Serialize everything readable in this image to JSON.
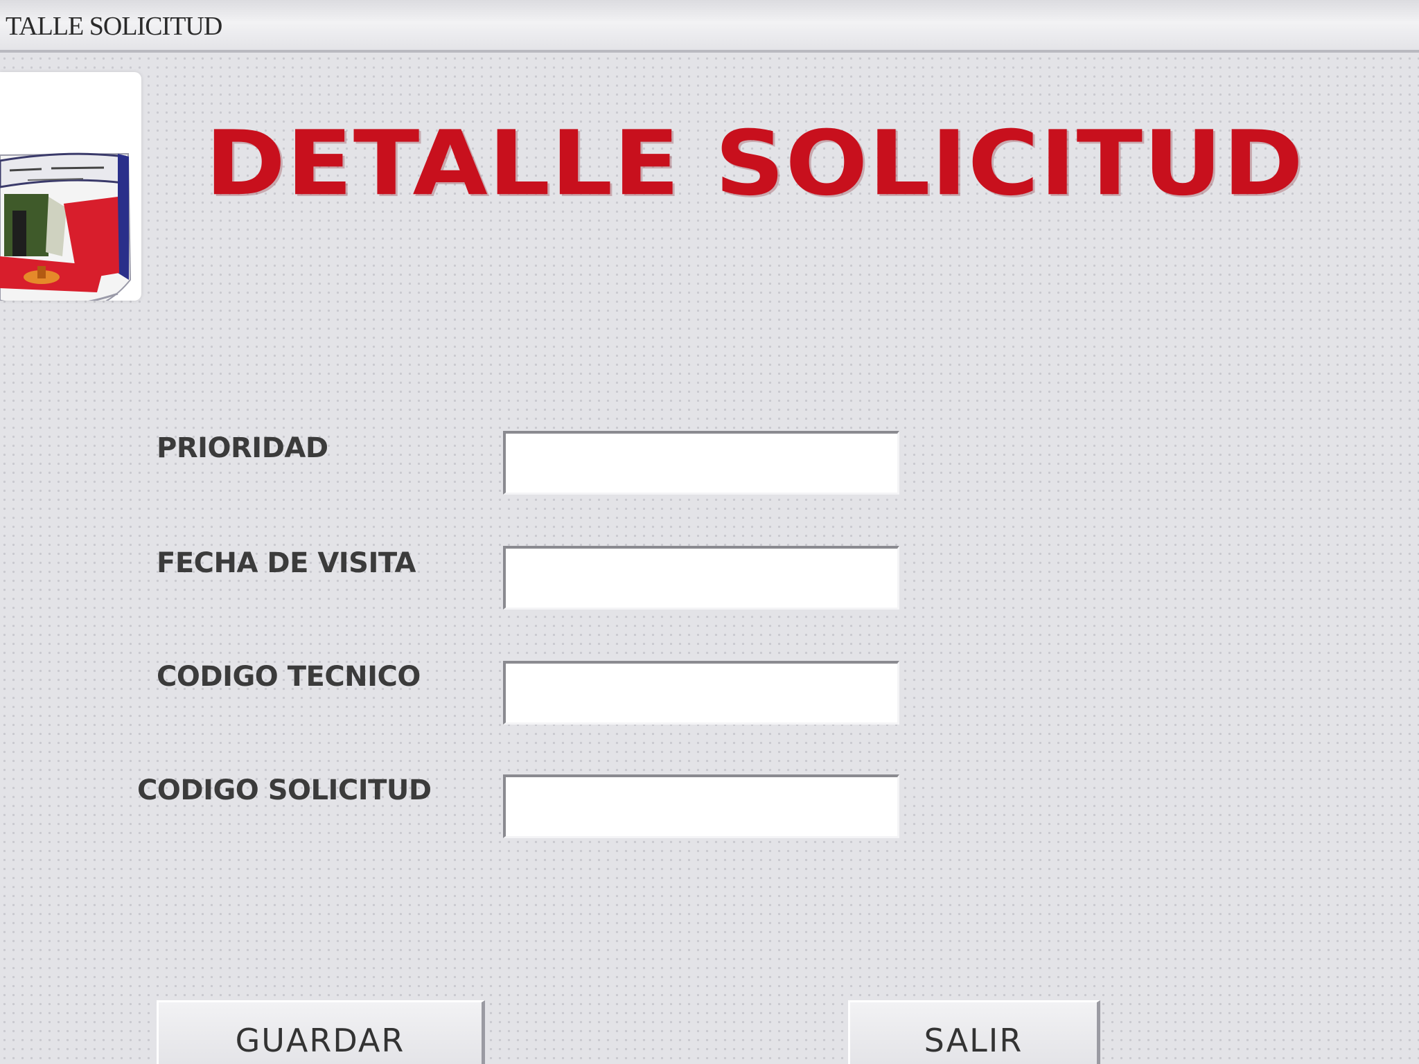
{
  "window": {
    "title": "TALLE SOLICITUD"
  },
  "header": {
    "logo": "school-crest",
    "heading": "DETALLE SOLICITUD",
    "heading_color": "#c8101d"
  },
  "form": {
    "fields": [
      {
        "label": "PRIORIDAD",
        "value": ""
      },
      {
        "label": "FECHA DE VISITA",
        "value": ""
      },
      {
        "label": "CODIGO TECNICO",
        "value": ""
      },
      {
        "label": "CODIGO SOLICITUD",
        "value": ""
      }
    ]
  },
  "actions": {
    "save_label": "GUARDAR",
    "exit_label": "SALIR"
  }
}
